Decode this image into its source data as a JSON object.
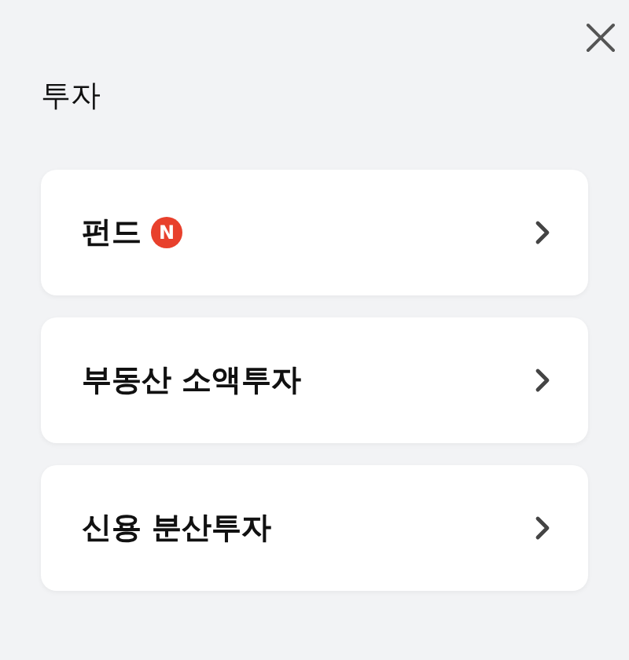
{
  "title": "투자",
  "items": [
    {
      "label": "펀드",
      "badge": "N"
    },
    {
      "label": "부동산 소액투자"
    },
    {
      "label": "신용 분산투자"
    }
  ]
}
